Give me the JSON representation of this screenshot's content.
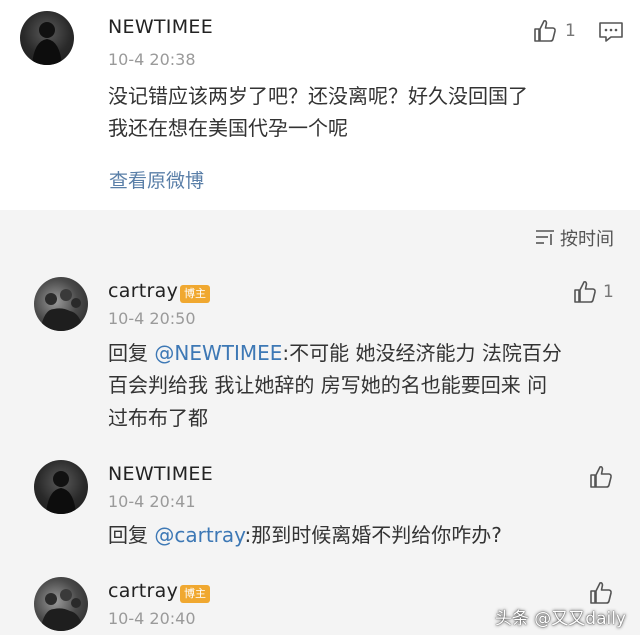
{
  "main_comment": {
    "author": "NEWTIMEE",
    "time": "10-4 20:38",
    "like_count": "1",
    "text_line1": "没记错应该两岁了吧？还没离呢？好久没回国了",
    "text_line2": "我还在想在美国代孕一个呢",
    "view_original": "查看原微博"
  },
  "sort_label": "按时间",
  "replies": [
    {
      "author": "cartray",
      "badge": "博主",
      "time": "10-4 20:50",
      "like_count": "1",
      "prefix": "回复 ",
      "mention": "@NEWTIMEE",
      "line1_rest": ":不可能 她没经济能力 法院百分",
      "line2": "百会判给我  我让她辞的 房写她的名也能要回来 问",
      "line3": "过布布了都"
    },
    {
      "author": "NEWTIMEE",
      "time": "10-4 20:41",
      "prefix": "回复 ",
      "mention": "@cartray",
      "line1_rest": ":那到时候离婚不判给你咋办?"
    },
    {
      "author": "cartray",
      "badge": "博主",
      "time": "10-4 20:40"
    }
  ],
  "watermark": "头条 @又又daily"
}
